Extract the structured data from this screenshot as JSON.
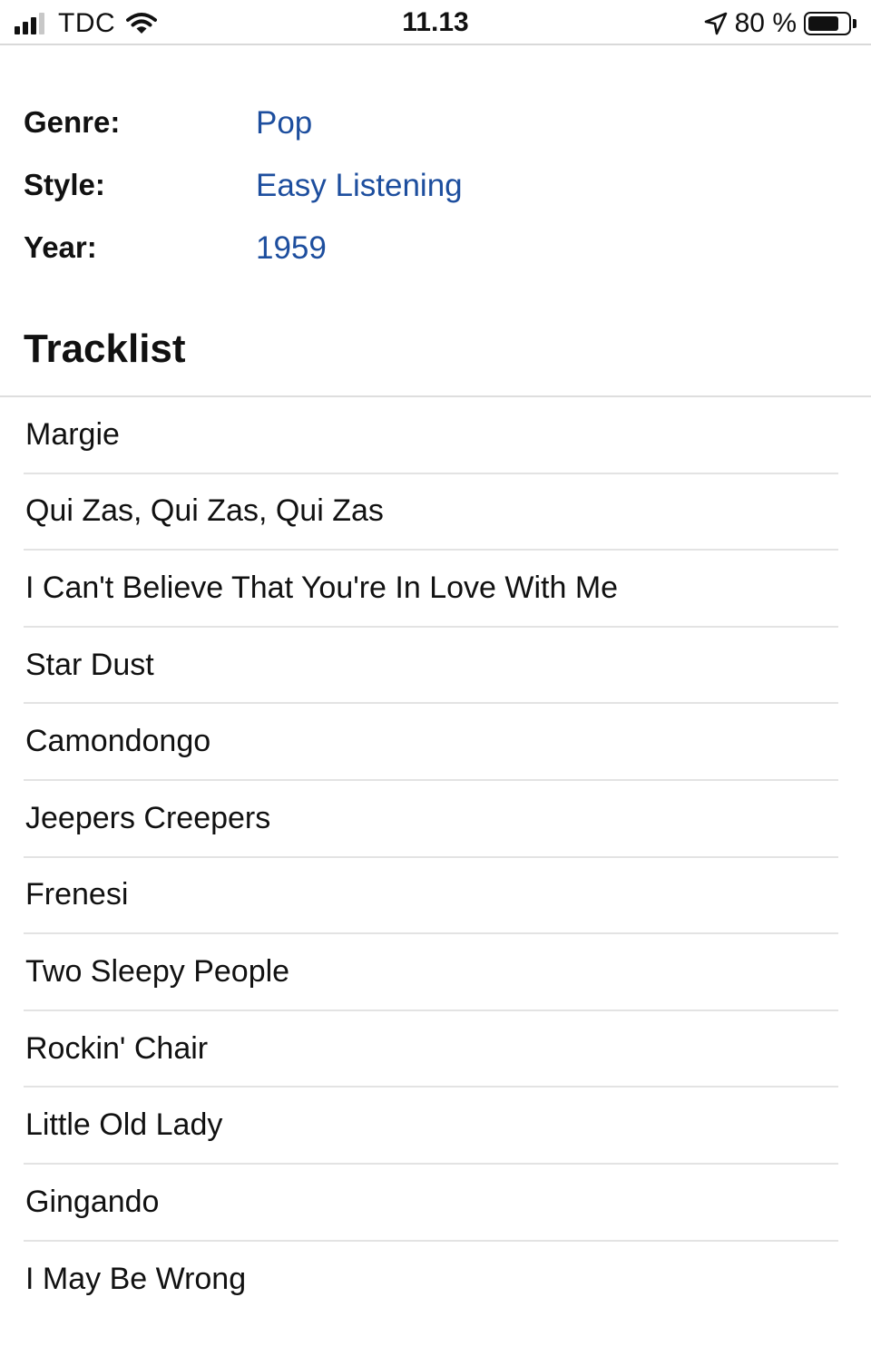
{
  "status_bar": {
    "carrier": "TDC",
    "time": "11.13",
    "battery": "80 %",
    "battery_level": 0.8,
    "signal_bars_active": 3,
    "signal_bars_total": 4,
    "icons": [
      "signal-icon",
      "wifi-icon",
      "location-arrow-icon",
      "battery-icon"
    ]
  },
  "details": [
    {
      "label": "Genre:",
      "value": "Pop"
    },
    {
      "label": "Style:",
      "value": "Easy Listening"
    },
    {
      "label": "Year:",
      "value": "1959"
    }
  ],
  "colors": {
    "link": "#1d4e9e",
    "text": "#111111",
    "divider": "#e3e3e3"
  },
  "tracklist": {
    "heading": "Tracklist",
    "tracks": [
      "Margie",
      "Qui Zas, Qui Zas, Qui Zas",
      "I Can't Believe That You're In Love With Me",
      "Star Dust",
      "Camondongo",
      "Jeepers Creepers",
      "Frenesi",
      "Two Sleepy People",
      "Rockin' Chair",
      "Little Old Lady",
      "Gingando",
      "I May Be Wrong"
    ]
  }
}
